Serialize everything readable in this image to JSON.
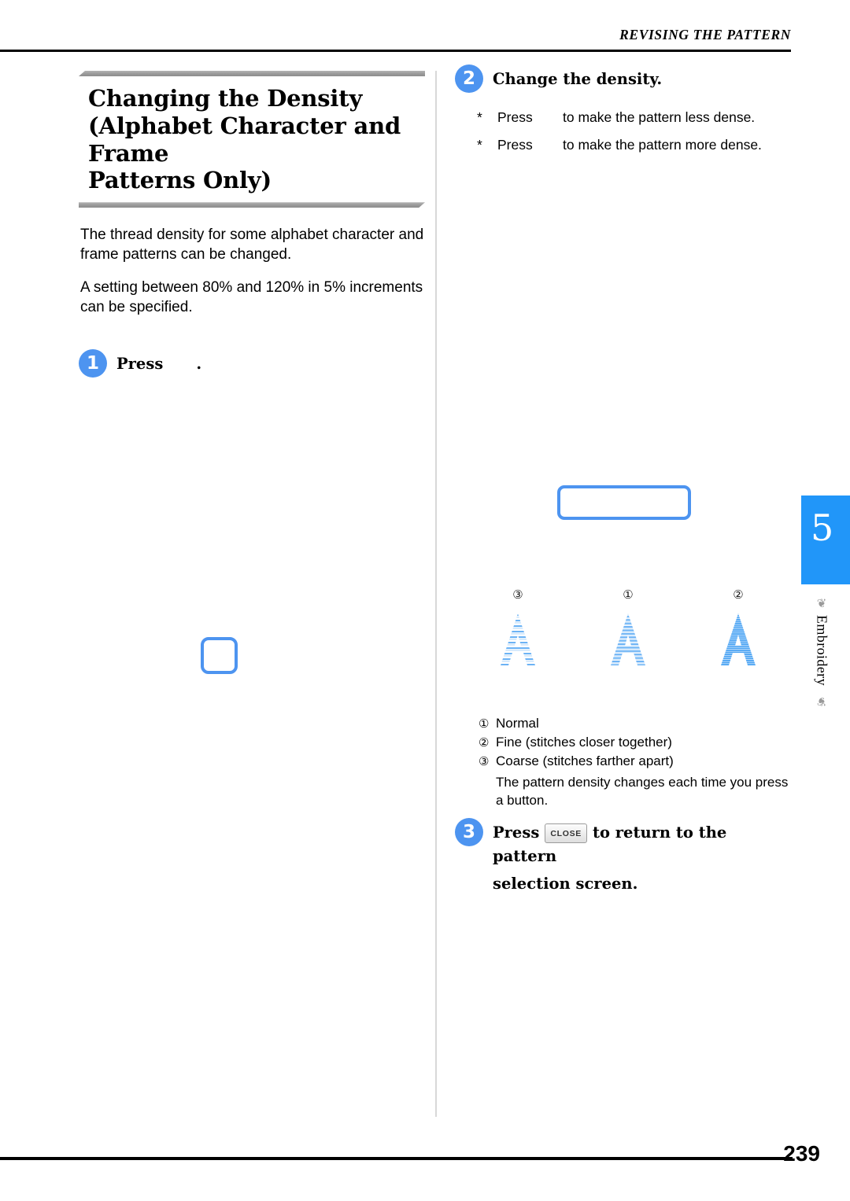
{
  "header": {
    "running_head": "REVISING THE PATTERN"
  },
  "left_column": {
    "title_lines": [
      "Changing the Density",
      "(Alphabet Character and Frame",
      "Patterns Only)"
    ],
    "paragraphs": [
      "The thread density for some alphabet character and frame patterns can be changed.",
      "A setting between 80% and 120% in 5% increments can be specified."
    ],
    "step1": {
      "number": "1",
      "label": "Press",
      "trailing": "."
    }
  },
  "right_column": {
    "step2": {
      "number": "2",
      "label": "Change the density."
    },
    "bullets": [
      {
        "star": "*",
        "press": "Press",
        "text": "to make the pattern less dense."
      },
      {
        "star": "*",
        "press": "Press",
        "text": "to make the pattern more dense."
      }
    ],
    "samples": [
      {
        "marker": "③",
        "name": "coarse-sample",
        "density": "coarse"
      },
      {
        "marker": "①",
        "name": "normal-sample",
        "density": "normal"
      },
      {
        "marker": "②",
        "name": "fine-sample",
        "density": "fine"
      }
    ],
    "legend": [
      {
        "mark": "①",
        "text": "Normal"
      },
      {
        "mark": "②",
        "text": "Fine (stitches closer together)"
      },
      {
        "mark": "③",
        "text": "Coarse (stitches farther apart)"
      }
    ],
    "legend_note": "The pattern density changes each time you press a button.",
    "step3": {
      "number": "3",
      "press_label": "Press",
      "close_key": "CLOSE",
      "line1_rest": "to return to the pattern",
      "line2": "selection screen."
    }
  },
  "chapter_tab": {
    "number": "5",
    "label": "Embroidery",
    "ornament": "❦"
  },
  "footer": {
    "page_number": "239"
  },
  "colors": {
    "accent_blue": "#4d94f0",
    "tab_blue": "#2196f9",
    "rule_black": "#000000",
    "bar_gray": "#9a9a9a"
  }
}
